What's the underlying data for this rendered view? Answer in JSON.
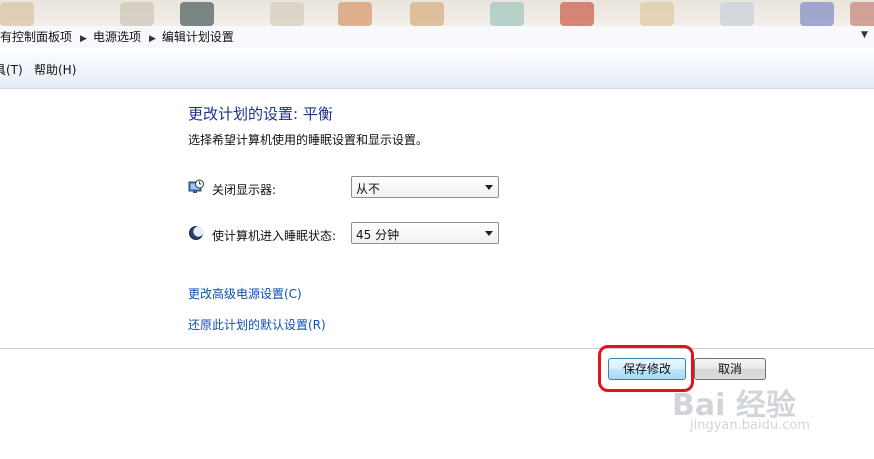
{
  "breadcrumb": {
    "items": [
      "有控制面板项",
      "电源选项",
      "编辑计划设置"
    ],
    "separator": "▶"
  },
  "menu": {
    "items": [
      "具(T)",
      "帮助(H)"
    ]
  },
  "header": {
    "title": "更改计划的设置: 平衡",
    "subtitle": "选择希望计算机使用的睡眠设置和显示设置。"
  },
  "settings": {
    "display_off": {
      "label": "关闭显示器:",
      "value": "从不",
      "icon": "monitor-clock-icon"
    },
    "sleep": {
      "label": "使计算机进入睡眠状态:",
      "value": "45 分钟",
      "icon": "moon-icon"
    }
  },
  "links": {
    "advanced": "更改高级电源设置(C)",
    "restore": "还原此计划的默认设置(R)"
  },
  "buttons": {
    "save": "保存修改",
    "cancel": "取消"
  },
  "watermark": {
    "brand": "Bai 经验",
    "url": "jingyan.baidu.com"
  },
  "colors": {
    "title": "#1e3287",
    "link": "#0f4fb0",
    "highlight": "#e0141e"
  }
}
